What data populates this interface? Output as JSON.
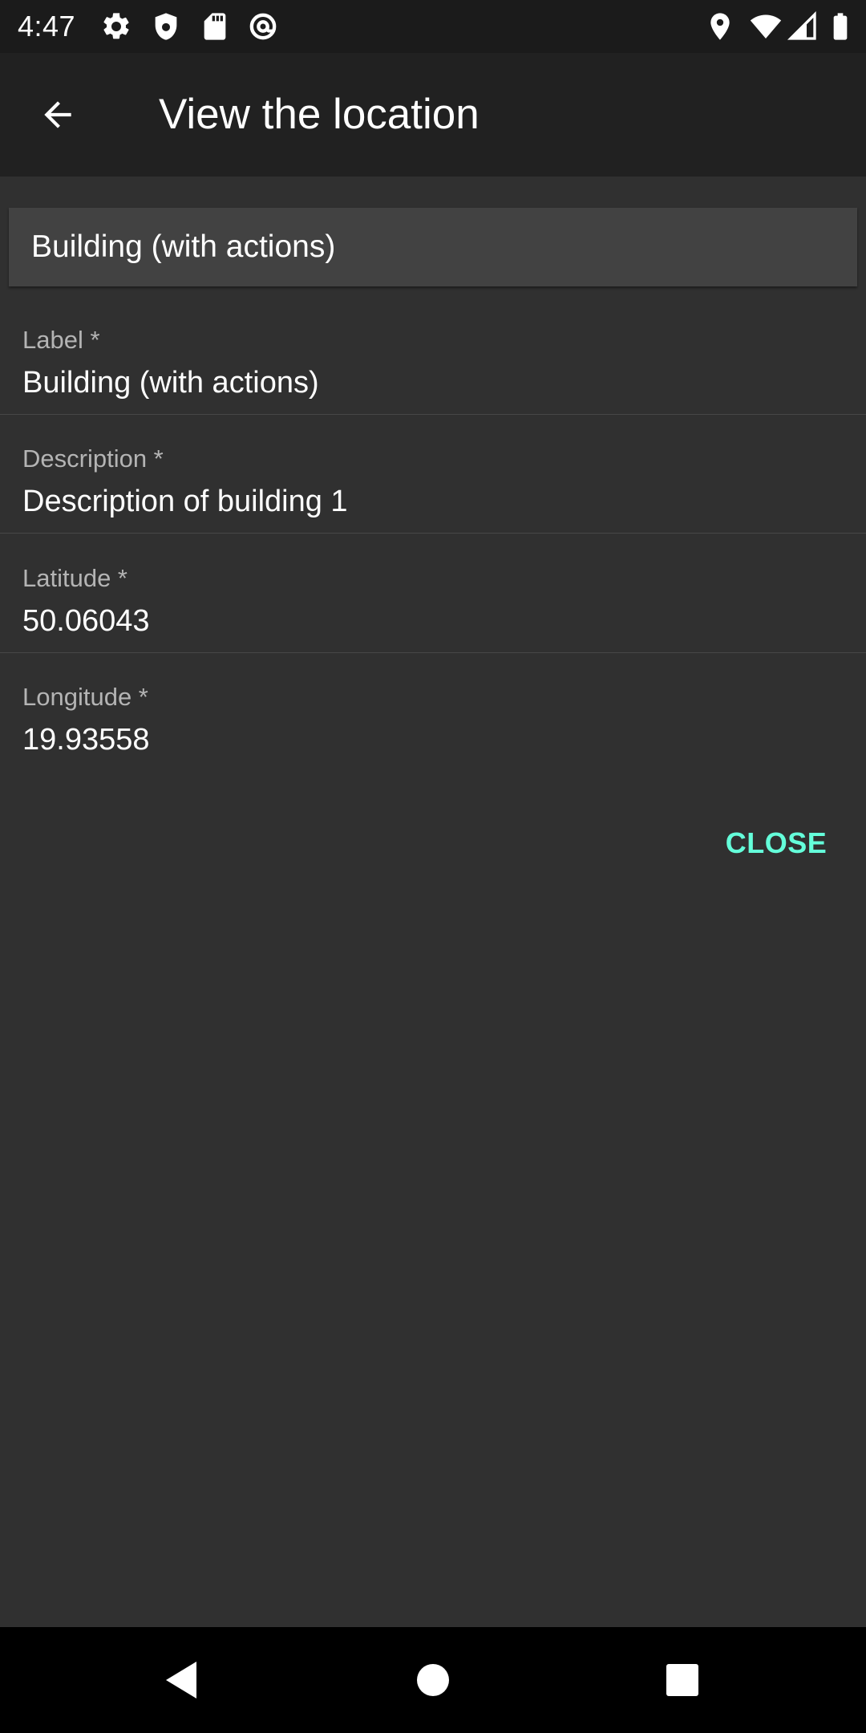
{
  "status_bar": {
    "time": "4:47",
    "left_icons": [
      "settings-icon",
      "shield-icon",
      "sd-card-icon",
      "at-sign-icon"
    ],
    "right_icons": [
      "location-pin-icon",
      "wifi-icon",
      "cellular-signal-icon",
      "battery-icon"
    ]
  },
  "app_bar": {
    "title": "View the location",
    "back_icon": "arrow-left-icon"
  },
  "header_card": {
    "title": "Building (with actions)"
  },
  "fields": [
    {
      "label": "Label *",
      "value": "Building (with actions)"
    },
    {
      "label": "Description *",
      "value": "Description of building 1"
    },
    {
      "label": "Latitude *",
      "value": "50.06043"
    },
    {
      "label": "Longitude *",
      "value": "19.93558"
    }
  ],
  "actions": {
    "close_label": "CLOSE"
  },
  "nav_bar": {
    "icons": [
      "nav-back-icon",
      "nav-home-icon",
      "nav-recents-icon"
    ]
  },
  "colors": {
    "accent": "#64ffda",
    "background": "#303030",
    "app_bar": "#212121",
    "card": "#424242",
    "status_bar": "#1b1b1b"
  }
}
